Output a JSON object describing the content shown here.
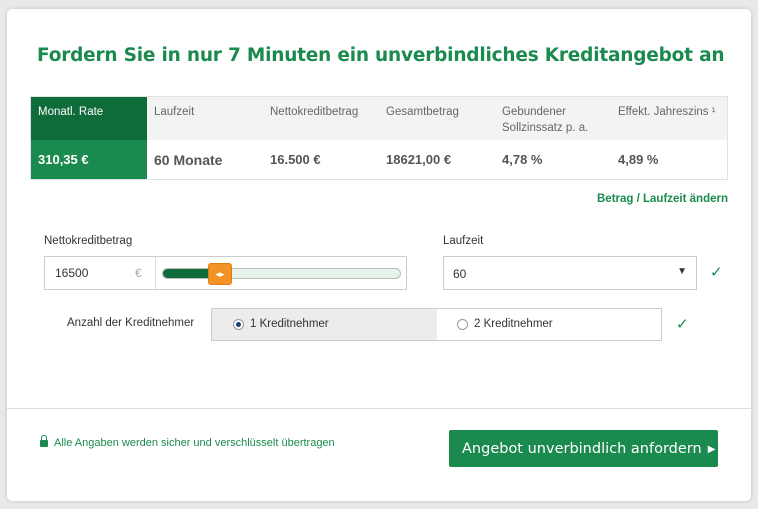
{
  "headline": "Fordern Sie in nur 7 Minuten ein unverbindliches Kreditangebot an",
  "summary": {
    "columns": [
      {
        "label": "Monatl. Rate",
        "value": "310,35 €"
      },
      {
        "label": "Laufzeit",
        "value": "60 Monate"
      },
      {
        "label": "Nettokreditbetrag",
        "value": "16.500 €"
      },
      {
        "label": "Gesamtbetrag",
        "value": "18621,00 €"
      },
      {
        "label": "Gebundener Sollzinssatz p. a.",
        "value": "4,78 %"
      },
      {
        "label": "Effekt. Jahreszins ¹",
        "value": "4,89 %"
      }
    ]
  },
  "change_link": "Betrag / Laufzeit ändern",
  "amount": {
    "label": "Nettokreditbetrag",
    "value": "16500",
    "currency": "€",
    "slider_fraction": 0.24
  },
  "term": {
    "label": "Laufzeit",
    "selected": "60"
  },
  "borrowers": {
    "label": "Anzahl der Kreditnehmer",
    "options": [
      "1 Kreditnehmer",
      "2 Kreditnehmer"
    ],
    "selected_index": 0
  },
  "footer": {
    "secure_note": "Alle Angaben werden sicher und verschlüsselt übertragen",
    "cta_label": "Angebot unverbindlich anfordern"
  },
  "colors": {
    "brand_green": "#1b8a4e",
    "dark_green": "#0e6b3a",
    "slider_handle": "#f39325"
  },
  "icons": {
    "check": "check-icon",
    "lock": "lock-icon",
    "dropdown": "caret-down-icon",
    "cta_arrow": "arrow-right-icon",
    "slider_handle": "double-arrow-icon"
  }
}
